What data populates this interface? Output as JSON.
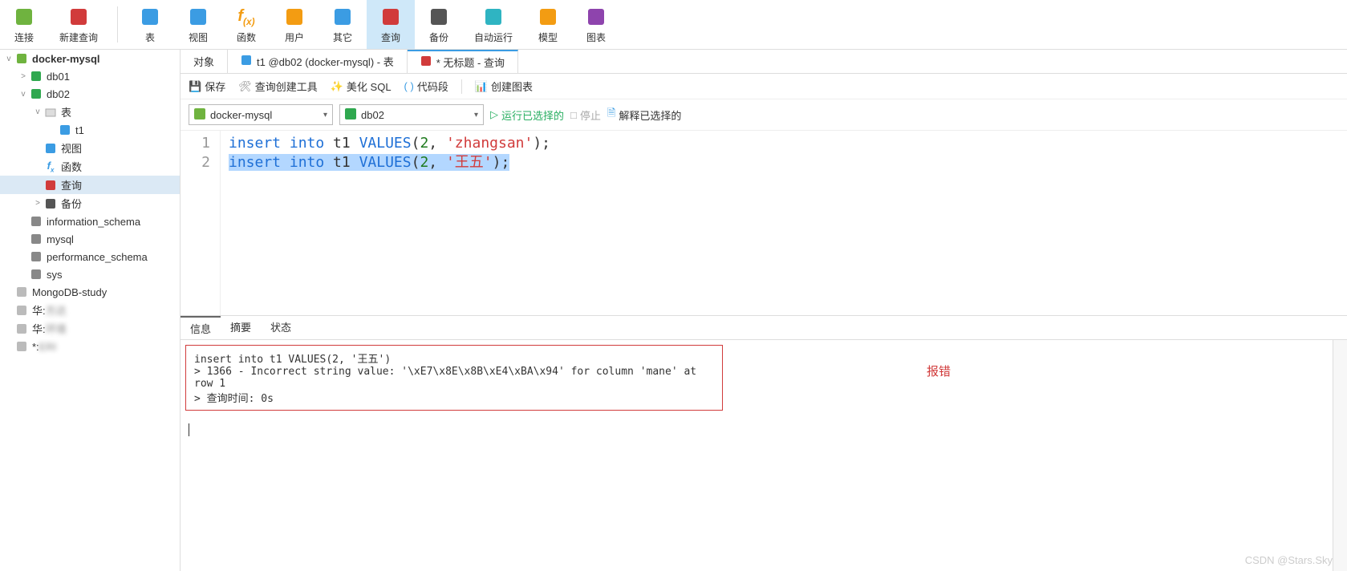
{
  "toolbar": [
    {
      "name": "connect",
      "label": "连接",
      "color": "#6fb33f"
    },
    {
      "name": "newquery",
      "label": "新建查询",
      "color": "#d13b3b"
    },
    {
      "name": "table",
      "label": "表",
      "color": "#3b9ce3"
    },
    {
      "name": "view",
      "label": "视图",
      "color": "#3b9ce3"
    },
    {
      "name": "function",
      "label": "函数",
      "color": "#f39c12",
      "fx": true
    },
    {
      "name": "user",
      "label": "用户",
      "color": "#f39c12"
    },
    {
      "name": "other",
      "label": "其它",
      "color": "#3b9ce3"
    },
    {
      "name": "query",
      "label": "查询",
      "color": "#d13b3b",
      "active": true
    },
    {
      "name": "backup",
      "label": "备份",
      "color": "#555"
    },
    {
      "name": "autorun",
      "label": "自动运行",
      "color": "#2fb4c2"
    },
    {
      "name": "model",
      "label": "模型",
      "color": "#f39c12"
    },
    {
      "name": "chart",
      "label": "图表",
      "color": "#8e44ad"
    }
  ],
  "tree": {
    "root": "docker-mysql",
    "items": [
      {
        "indent": 1,
        "caret": ">",
        "ico": "db",
        "label": "db01"
      },
      {
        "indent": 1,
        "caret": "v",
        "ico": "db",
        "label": "db02"
      },
      {
        "indent": 2,
        "caret": "v",
        "ico": "folder",
        "label": "表"
      },
      {
        "indent": 3,
        "caret": "",
        "ico": "table",
        "label": "t1"
      },
      {
        "indent": 2,
        "caret": "",
        "ico": "view",
        "label": "视图"
      },
      {
        "indent": 2,
        "caret": "",
        "ico": "fx",
        "label": "函数"
      },
      {
        "indent": 2,
        "caret": "",
        "ico": "query",
        "label": "查询",
        "active": true
      },
      {
        "indent": 2,
        "caret": ">",
        "ico": "backup",
        "label": "备份"
      },
      {
        "indent": 1,
        "caret": "",
        "ico": "db-off",
        "label": "information_schema"
      },
      {
        "indent": 1,
        "caret": "",
        "ico": "db-off",
        "label": "mysql"
      },
      {
        "indent": 1,
        "caret": "",
        "ico": "db-off",
        "label": "performance_schema"
      },
      {
        "indent": 1,
        "caret": "",
        "ico": "db-off",
        "label": "sys"
      }
    ],
    "extras": [
      "MongoDB-study",
      "华:",
      "华:",
      "*:"
    ],
    "extra_suffix": [
      "",
      "方达",
      "环境",
      "ERI"
    ]
  },
  "tabs": [
    {
      "label": "对象"
    },
    {
      "label": "t1 @db02 (docker-mysql) - 表",
      "ico": "table"
    },
    {
      "label": "* 无标题 - 查询",
      "ico": "query",
      "active": true
    }
  ],
  "subtoolbar": {
    "save": "保存",
    "qtool": "查询创建工具",
    "beautify": "美化 SQL",
    "snippet": "代码段",
    "chart": "创建图表"
  },
  "querybar": {
    "conn": "docker-mysql",
    "db": "db02",
    "run": "运行已选择的",
    "stop": "停止",
    "explain": "解释已选择的"
  },
  "sql": {
    "lines": [
      {
        "n": "1",
        "parts": [
          [
            "insert into ",
            "kw-blue"
          ],
          [
            "t1 ",
            ""
          ],
          [
            "VALUES",
            "kw-blue"
          ],
          [
            "(",
            ""
          ],
          [
            "2",
            "kw-num"
          ],
          [
            ", ",
            ""
          ],
          [
            "'zhangsan'",
            "kw-str"
          ],
          [
            ");",
            ""
          ]
        ]
      },
      {
        "n": "2",
        "sel": true,
        "parts": [
          [
            "insert into ",
            "kw-blue"
          ],
          [
            "t1 ",
            ""
          ],
          [
            "VALUES",
            "kw-blue"
          ],
          [
            "(",
            ""
          ],
          [
            "2",
            "kw-num"
          ],
          [
            ", ",
            ""
          ],
          [
            "'王五'",
            "kw-str"
          ],
          [
            ");",
            ""
          ]
        ]
      }
    ]
  },
  "result_tabs": [
    "信息",
    "摘要",
    "状态"
  ],
  "error": {
    "l1": "insert into t1 VALUES(2, '王五')",
    "l2": "> 1366 - Incorrect string value: '\\xE7\\x8E\\x8B\\xE4\\xBA\\x94' for column 'mane' at row 1",
    "l3": "> 查询时间: 0s",
    "label": "报错"
  },
  "watermark": "CSDN @Stars.Sky"
}
